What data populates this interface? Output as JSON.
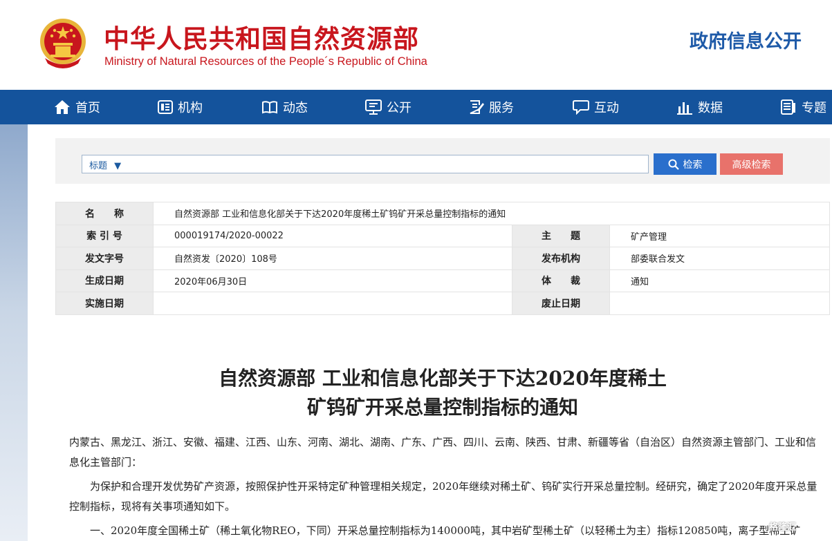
{
  "header": {
    "title_cn": "中华人民共和国自然资源部",
    "title_en": "Ministry of Natural Resources of the People´s Republic of China",
    "right_title": "政府信息公开"
  },
  "nav": [
    {
      "label": "首页",
      "icon": "home-icon"
    },
    {
      "label": "机构",
      "icon": "organization-icon"
    },
    {
      "label": "动态",
      "icon": "book-icon"
    },
    {
      "label": "公开",
      "icon": "monitor-icon"
    },
    {
      "label": "服务",
      "icon": "document-edit-icon"
    },
    {
      "label": "互动",
      "icon": "chat-icon"
    },
    {
      "label": "数据",
      "icon": "bar-chart-icon"
    },
    {
      "label": "专题",
      "icon": "topic-icon"
    }
  ],
  "search": {
    "type_label": "标题",
    "value": "",
    "search_button": "检索",
    "advanced_button": "高级检索"
  },
  "meta": {
    "name_key": "名　　称",
    "name_val": "自然资源部 工业和信息化部关于下达2020年度稀土矿钨矿开采总量控制指标的通知",
    "index_key": "索 引 号",
    "index_val": "000019174/2020-00022",
    "subject_key": "主　　题",
    "subject_val": "矿产管理",
    "doc_no_key": "发文字号",
    "doc_no_val": "自然资发〔2020〕108号",
    "publisher_key": "发布机构",
    "publisher_val": "部委联合发文",
    "date_key": "生成日期",
    "date_val": "2020年06月30日",
    "genre_key": "体　　裁",
    "genre_val": "通知",
    "effective_key": "实施日期",
    "effective_val": "",
    "expire_key": "废止日期",
    "expire_val": ""
  },
  "article": {
    "title_line1": "自然资源部 工业和信息化部关于下达2020年度稀土",
    "title_line2": "矿钨矿开采总量控制指标的通知",
    "recipients": "内蒙古、黑龙江、浙江、安徽、福建、江西、山东、河南、湖北、湖南、广东、广西、四川、云南、陕西、甘肃、新疆等省（自治区）自然资源主管部门、工业和信息化主管部门：",
    "para1": "为保护和合理开发优势矿产资源，按照保护性开采特定矿种管理相关规定，2020年继续对稀土矿、钨矿实行开采总量控制。经研究，确定了2020年度开采总量控制指标，现将有关事项通知如下。",
    "para2": "一、2020年度全国稀土矿（稀土氧化物REO，下同）开采总量控制指标为140000吨，其中岩矿型稀土矿（以轻稀土为主）指标120850吨，离子型稀土矿"
  },
  "watermark": "格隆汇"
}
